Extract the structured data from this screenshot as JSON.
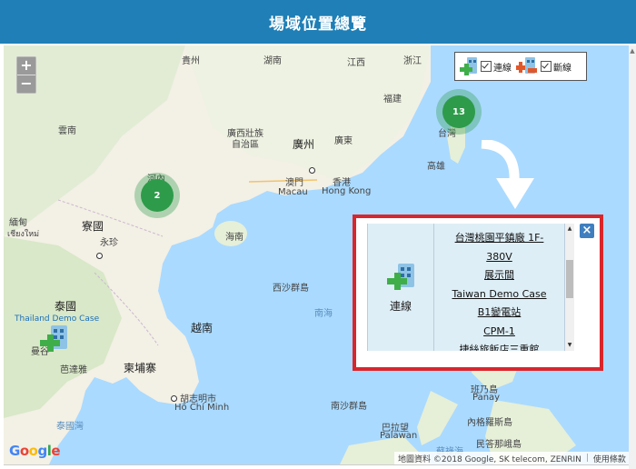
{
  "header": {
    "title": "場域位置總覽"
  },
  "map": {
    "zoom": {
      "in": "+",
      "out": "−"
    },
    "labels": {
      "guizhou": "貴州",
      "hunan": "湖南",
      "jiangxi": "江西",
      "zhejiang": "浙江",
      "fujian": "福建",
      "guangxi": "廣西壯族\n自治區",
      "guangdong": "廣東",
      "guangzhou": "廣州",
      "yunnan": "雲南",
      "macau_zh": "澳門",
      "macau_en": "Macau",
      "hk_zh": "香港",
      "hk_en": "Hong Kong",
      "taiwan": "台灣",
      "kaohsiung": "高雄",
      "hanoi": "河內",
      "laos": "寮國",
      "vientiane": "永珍",
      "hainan": "海南",
      "xisha": "西沙群島",
      "south_sea": "南海",
      "thailand": "泰國",
      "thailand_demo": "Thailand Demo Case",
      "bangkok": "曼谷",
      "pattaya": "芭達雅",
      "cambodia": "柬埔寨",
      "vietnam": "越南",
      "hcm_zh": "胡志明市",
      "hcm_en": "Hồ Chí Minh",
      "nansha": "南沙群島",
      "gulf_thailand": "泰國灣",
      "palawan_zh": "巴拉望",
      "palawan_en": "Palawan",
      "panay_zh": "班乃島",
      "panay_en": "Panay",
      "negros": "內格羅斯島",
      "mindoro": "民答那峨島",
      "sulu": "蘇祿海",
      "myanmar": "緬甸",
      "vientiane_th": "เชียงใหม่"
    },
    "clusters": [
      {
        "count": "13",
        "color": "#2e9b4a"
      },
      {
        "count": "2",
        "color": "#2e9b4a"
      }
    ],
    "legend": {
      "connected": "連線",
      "disconnected": "斷線"
    },
    "popup": {
      "status_label": "連線",
      "sites": [
        "台灣桃園平鎮廠 1F-",
        "380V",
        "展示間",
        "Taiwan Demo Case",
        "B1變電站",
        "CPM-1",
        "捷絲旅飯店三重館"
      ],
      "close": "×"
    },
    "google_logo": "Google",
    "attribution": {
      "data": "地圖資料 ©2018 Google, SK telecom, ZENRIN",
      "terms": "使用條款"
    }
  }
}
